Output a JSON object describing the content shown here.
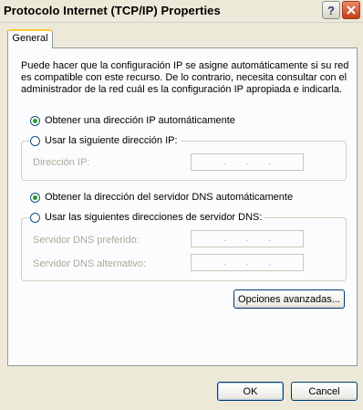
{
  "window": {
    "title": "Protocolo Internet (TCP/IP) Properties",
    "help_label": "?"
  },
  "tabs": [
    {
      "label": "General"
    }
  ],
  "intro_text": "Puede hacer que la configuración IP se asigne automáticamente si su red es compatible con este recurso. De lo contrario, necesita consultar con el administrador de la red cuál es la configuración IP apropiada e indicarla.",
  "ip_options": {
    "auto_label": "Obtener una dirección IP automáticamente",
    "manual_label": "Usar la siguiente dirección IP:",
    "selected": "auto",
    "address_label": "Dirección IP:",
    "address_value": ". . ."
  },
  "dns_options": {
    "auto_label": "Obtener la dirección del servidor DNS automáticamente",
    "manual_label": "Usar las siguientes direcciones de servidor DNS:",
    "selected": "auto",
    "preferred_label": "Servidor DNS preferido:",
    "alternate_label": "Servidor DNS alternativo:"
  },
  "advanced_button": "Opciones avanzadas...",
  "footer": {
    "ok": "OK",
    "cancel": "Cancel"
  }
}
